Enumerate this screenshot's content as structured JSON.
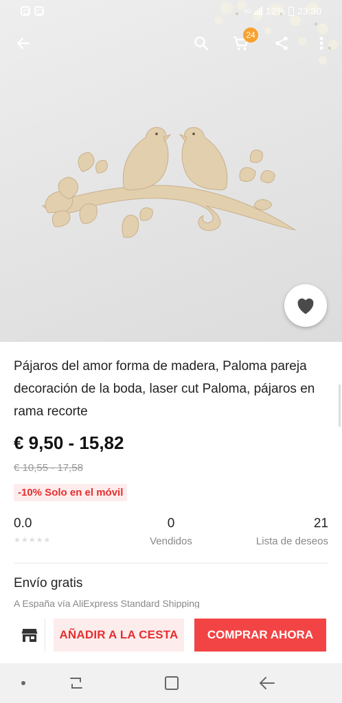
{
  "status_bar": {
    "network": "4G",
    "battery": "12%",
    "time": "23:30"
  },
  "app_bar": {
    "cart_count": "24"
  },
  "icons": {
    "back": "back-arrow-icon",
    "search": "search-icon",
    "cart": "cart-icon",
    "share": "share-icon",
    "more": "more-vert-icon",
    "favorite": "heart-icon",
    "store": "store-icon"
  },
  "product": {
    "title": "Pájaros del amor forma de madera, Paloma pareja decoración de la boda, laser cut Paloma, pájaros en rama recorte",
    "price": "€ 9,50 - 15,82",
    "old_price": "€ 10,55 - 17,58",
    "promo": "-10% Solo en el móvil"
  },
  "stats": {
    "rating": {
      "value": "0.0",
      "stars": 0
    },
    "sold": {
      "value": "0",
      "label": "Vendidos"
    },
    "wishlist": {
      "value": "21",
      "label": "Lista de deseos"
    }
  },
  "shipping": {
    "title": "Envío gratis",
    "subtitle": "A España vía AliExpress Standard Shipping"
  },
  "actions": {
    "add_to_cart": "AÑADIR A LA CESTA",
    "buy_now": "COMPRAR AHORA"
  },
  "colors": {
    "accent": "#f24444",
    "accent_light": "#fdecec",
    "badge": "#f7a230"
  }
}
